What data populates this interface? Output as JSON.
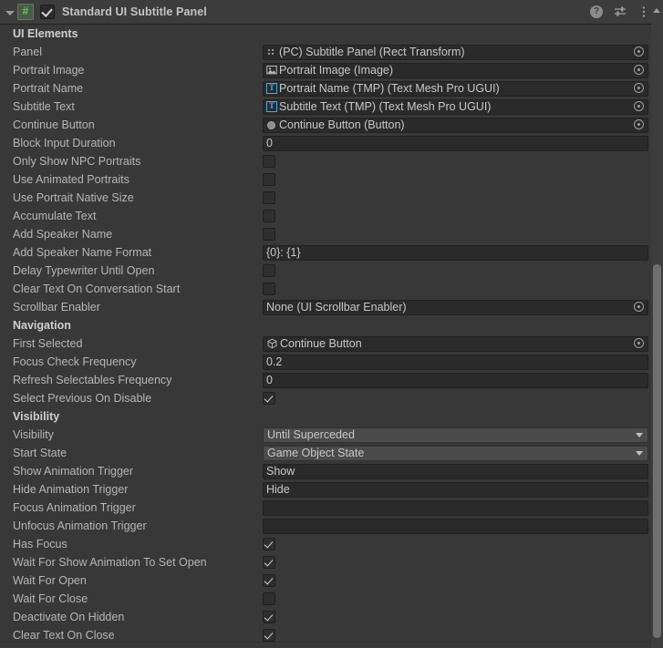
{
  "header": {
    "title": "Standard UI Subtitle Panel",
    "enabled": true,
    "foldout_expanded": true,
    "script_icon": "script-hash-icon",
    "icons": [
      {
        "name": "help-icon",
        "glyph": "?"
      },
      {
        "name": "preset-icon",
        "glyph": "sliders"
      },
      {
        "name": "more-menu-icon",
        "glyph": "kebab"
      }
    ]
  },
  "sections": [
    {
      "title": "UI Elements",
      "rows": [
        {
          "label": "Panel",
          "type": "object",
          "value": "(PC) Subtitle Panel (Rect Transform)",
          "icon": "rect-transform-icon"
        },
        {
          "label": "Portrait Image",
          "type": "object",
          "value": "Portrait Image (Image)",
          "icon": "image-icon"
        },
        {
          "label": "Portrait Name",
          "type": "object",
          "value": "Portrait Name (TMP) (Text Mesh Pro UGUI)",
          "icon": "tmp-text-icon"
        },
        {
          "label": "Subtitle Text",
          "type": "object",
          "value": "Subtitle Text (TMP) (Text Mesh Pro UGUI)",
          "icon": "tmp-text-icon"
        },
        {
          "label": "Continue Button",
          "type": "object",
          "value": "Continue Button (Button)",
          "icon": "button-icon"
        },
        {
          "label": "Block Input Duration",
          "type": "text",
          "value": "0"
        },
        {
          "label": "Only Show NPC Portraits",
          "type": "checkbox",
          "value": false
        },
        {
          "label": "Use Animated Portraits",
          "type": "checkbox",
          "value": false
        },
        {
          "label": "Use Portrait Native Size",
          "type": "checkbox",
          "value": false
        },
        {
          "label": "Accumulate Text",
          "type": "checkbox",
          "value": false
        },
        {
          "label": "Add Speaker Name",
          "type": "checkbox",
          "value": false
        },
        {
          "label": "Add Speaker Name Format",
          "type": "text",
          "value": "{0}: {1}"
        },
        {
          "label": "Delay Typewriter Until Open",
          "type": "checkbox",
          "value": false
        },
        {
          "label": "Clear Text On Conversation Start",
          "type": "checkbox",
          "value": false
        },
        {
          "label": "Scrollbar Enabler",
          "type": "object",
          "value": "None (UI Scrollbar Enabler)",
          "icon": "none-icon"
        }
      ]
    },
    {
      "title": "Navigation",
      "rows": [
        {
          "label": "First Selected",
          "type": "object",
          "value": "Continue Button",
          "icon": "gameobject-cube-icon"
        },
        {
          "label": "Focus Check Frequency",
          "type": "text",
          "value": "0.2"
        },
        {
          "label": "Refresh Selectables Frequency",
          "type": "text",
          "value": "0"
        },
        {
          "label": "Select Previous On Disable",
          "type": "checkbox",
          "value": true
        }
      ]
    },
    {
      "title": "Visibility",
      "rows": [
        {
          "label": "Visibility",
          "type": "dropdown",
          "value": "Until Superceded"
        },
        {
          "label": "Start State",
          "type": "dropdown",
          "value": "Game Object State"
        },
        {
          "label": "Show Animation Trigger",
          "type": "text",
          "value": "Show"
        },
        {
          "label": "Hide Animation Trigger",
          "type": "text",
          "value": "Hide"
        },
        {
          "label": "Focus Animation Trigger",
          "type": "text",
          "value": ""
        },
        {
          "label": "Unfocus Animation Trigger",
          "type": "text",
          "value": ""
        },
        {
          "label": "Has Focus",
          "type": "checkbox",
          "value": true
        },
        {
          "label": "Wait For Show Animation To Set Open",
          "type": "checkbox",
          "value": true
        },
        {
          "label": "Wait For Open",
          "type": "checkbox",
          "value": true
        },
        {
          "label": "Wait For Close",
          "type": "checkbox",
          "value": false
        },
        {
          "label": "Deactivate On Hidden",
          "type": "checkbox",
          "value": true
        },
        {
          "label": "Clear Text On Close",
          "type": "checkbox",
          "value": true
        }
      ]
    }
  ],
  "colors": {
    "background": "#383838",
    "header_background": "#3c3c3c",
    "field_background": "#2a2a2a",
    "dropdown_background": "#4b4b4b",
    "label_text": "#b6b6b6",
    "value_text": "#c8c8c8",
    "tmp_accent": "#3daee9",
    "script_accent": "#5ecb5e",
    "scrollbar_thumb": "#6f6f6f"
  },
  "scrollbar": {
    "visible": true,
    "orientation": "vertical"
  }
}
